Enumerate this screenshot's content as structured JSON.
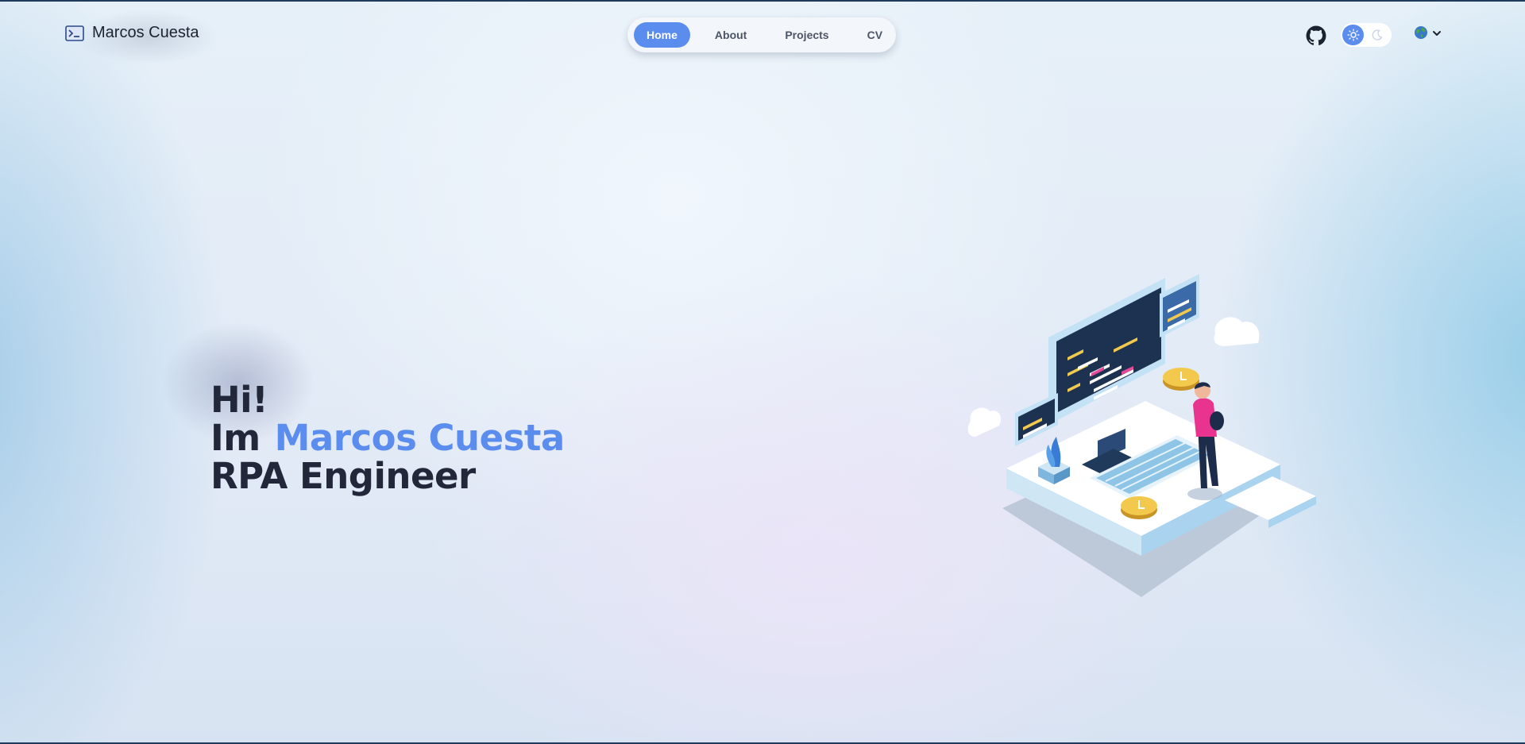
{
  "brand": {
    "name": "Marcos Cuesta",
    "icon": "terminal-icon"
  },
  "nav": {
    "items": [
      {
        "label": "Home",
        "active": true
      },
      {
        "label": "About",
        "active": false
      },
      {
        "label": "Projects",
        "active": false
      },
      {
        "label": "CV",
        "active": false
      }
    ]
  },
  "header_actions": {
    "github_icon": "github-icon",
    "theme_toggle": {
      "light_icon": "sun-icon",
      "dark_icon": "moon-icon",
      "mode": "light"
    },
    "language_icon": "globe-icon",
    "language_dropdown_icon": "chevron-down-icon"
  },
  "hero": {
    "greeting": "Hi!",
    "intro": "Im",
    "name": "Marcos Cuesta",
    "role": "RPA Engineer"
  },
  "illustration": "developer-workstation-illustration",
  "colors": {
    "accent": "#5b8def",
    "text_dark": "#22283a",
    "nav_bg": "#f3f6fa",
    "border": "#1f3a5a"
  }
}
